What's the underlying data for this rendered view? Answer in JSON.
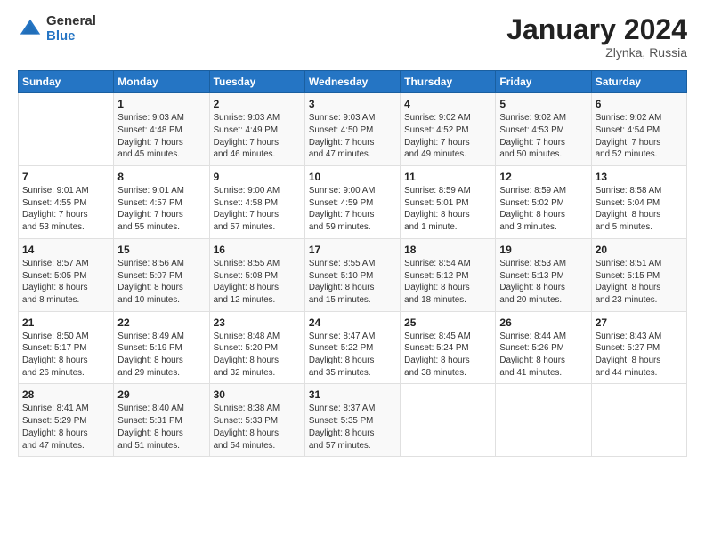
{
  "logo": {
    "general": "General",
    "blue": "Blue"
  },
  "header": {
    "month": "January 2024",
    "location": "Zlynka, Russia"
  },
  "weekdays": [
    "Sunday",
    "Monday",
    "Tuesday",
    "Wednesday",
    "Thursday",
    "Friday",
    "Saturday"
  ],
  "weeks": [
    [
      {
        "day": "",
        "info": ""
      },
      {
        "day": "1",
        "info": "Sunrise: 9:03 AM\nSunset: 4:48 PM\nDaylight: 7 hours\nand 45 minutes."
      },
      {
        "day": "2",
        "info": "Sunrise: 9:03 AM\nSunset: 4:49 PM\nDaylight: 7 hours\nand 46 minutes."
      },
      {
        "day": "3",
        "info": "Sunrise: 9:03 AM\nSunset: 4:50 PM\nDaylight: 7 hours\nand 47 minutes."
      },
      {
        "day": "4",
        "info": "Sunrise: 9:02 AM\nSunset: 4:52 PM\nDaylight: 7 hours\nand 49 minutes."
      },
      {
        "day": "5",
        "info": "Sunrise: 9:02 AM\nSunset: 4:53 PM\nDaylight: 7 hours\nand 50 minutes."
      },
      {
        "day": "6",
        "info": "Sunrise: 9:02 AM\nSunset: 4:54 PM\nDaylight: 7 hours\nand 52 minutes."
      }
    ],
    [
      {
        "day": "7",
        "info": "Sunrise: 9:01 AM\nSunset: 4:55 PM\nDaylight: 7 hours\nand 53 minutes."
      },
      {
        "day": "8",
        "info": "Sunrise: 9:01 AM\nSunset: 4:57 PM\nDaylight: 7 hours\nand 55 minutes."
      },
      {
        "day": "9",
        "info": "Sunrise: 9:00 AM\nSunset: 4:58 PM\nDaylight: 7 hours\nand 57 minutes."
      },
      {
        "day": "10",
        "info": "Sunrise: 9:00 AM\nSunset: 4:59 PM\nDaylight: 7 hours\nand 59 minutes."
      },
      {
        "day": "11",
        "info": "Sunrise: 8:59 AM\nSunset: 5:01 PM\nDaylight: 8 hours\nand 1 minute."
      },
      {
        "day": "12",
        "info": "Sunrise: 8:59 AM\nSunset: 5:02 PM\nDaylight: 8 hours\nand 3 minutes."
      },
      {
        "day": "13",
        "info": "Sunrise: 8:58 AM\nSunset: 5:04 PM\nDaylight: 8 hours\nand 5 minutes."
      }
    ],
    [
      {
        "day": "14",
        "info": "Sunrise: 8:57 AM\nSunset: 5:05 PM\nDaylight: 8 hours\nand 8 minutes."
      },
      {
        "day": "15",
        "info": "Sunrise: 8:56 AM\nSunset: 5:07 PM\nDaylight: 8 hours\nand 10 minutes."
      },
      {
        "day": "16",
        "info": "Sunrise: 8:55 AM\nSunset: 5:08 PM\nDaylight: 8 hours\nand 12 minutes."
      },
      {
        "day": "17",
        "info": "Sunrise: 8:55 AM\nSunset: 5:10 PM\nDaylight: 8 hours\nand 15 minutes."
      },
      {
        "day": "18",
        "info": "Sunrise: 8:54 AM\nSunset: 5:12 PM\nDaylight: 8 hours\nand 18 minutes."
      },
      {
        "day": "19",
        "info": "Sunrise: 8:53 AM\nSunset: 5:13 PM\nDaylight: 8 hours\nand 20 minutes."
      },
      {
        "day": "20",
        "info": "Sunrise: 8:51 AM\nSunset: 5:15 PM\nDaylight: 8 hours\nand 23 minutes."
      }
    ],
    [
      {
        "day": "21",
        "info": "Sunrise: 8:50 AM\nSunset: 5:17 PM\nDaylight: 8 hours\nand 26 minutes."
      },
      {
        "day": "22",
        "info": "Sunrise: 8:49 AM\nSunset: 5:19 PM\nDaylight: 8 hours\nand 29 minutes."
      },
      {
        "day": "23",
        "info": "Sunrise: 8:48 AM\nSunset: 5:20 PM\nDaylight: 8 hours\nand 32 minutes."
      },
      {
        "day": "24",
        "info": "Sunrise: 8:47 AM\nSunset: 5:22 PM\nDaylight: 8 hours\nand 35 minutes."
      },
      {
        "day": "25",
        "info": "Sunrise: 8:45 AM\nSunset: 5:24 PM\nDaylight: 8 hours\nand 38 minutes."
      },
      {
        "day": "26",
        "info": "Sunrise: 8:44 AM\nSunset: 5:26 PM\nDaylight: 8 hours\nand 41 minutes."
      },
      {
        "day": "27",
        "info": "Sunrise: 8:43 AM\nSunset: 5:27 PM\nDaylight: 8 hours\nand 44 minutes."
      }
    ],
    [
      {
        "day": "28",
        "info": "Sunrise: 8:41 AM\nSunset: 5:29 PM\nDaylight: 8 hours\nand 47 minutes."
      },
      {
        "day": "29",
        "info": "Sunrise: 8:40 AM\nSunset: 5:31 PM\nDaylight: 8 hours\nand 51 minutes."
      },
      {
        "day": "30",
        "info": "Sunrise: 8:38 AM\nSunset: 5:33 PM\nDaylight: 8 hours\nand 54 minutes."
      },
      {
        "day": "31",
        "info": "Sunrise: 8:37 AM\nSunset: 5:35 PM\nDaylight: 8 hours\nand 57 minutes."
      },
      {
        "day": "",
        "info": ""
      },
      {
        "day": "",
        "info": ""
      },
      {
        "day": "",
        "info": ""
      }
    ]
  ]
}
